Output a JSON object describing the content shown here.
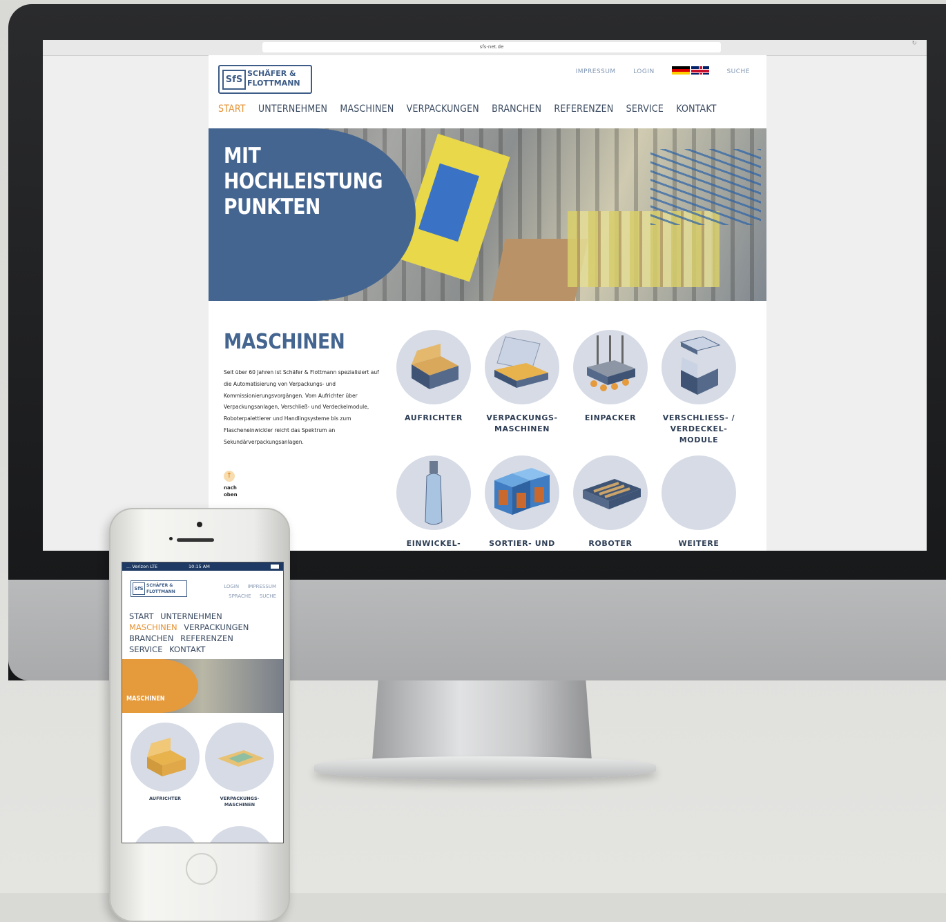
{
  "browser": {
    "url": "sfs-net.de"
  },
  "desktop_site": {
    "logo": {
      "mark": "SfS",
      "line1": "SCHÄFER &",
      "line2": "FLOTTMANN"
    },
    "top_links": [
      "IMPRESSUM",
      "LOGIN",
      "SUCHE"
    ],
    "nav": [
      {
        "label": "START",
        "active": true
      },
      {
        "label": "UNTERNEHMEN",
        "active": false
      },
      {
        "label": "MASCHINEN",
        "active": false
      },
      {
        "label": "VERPACKUNGEN",
        "active": false
      },
      {
        "label": "BRANCHEN",
        "active": false
      },
      {
        "label": "REFERENZEN",
        "active": false
      },
      {
        "label": "SERVICE",
        "active": false
      },
      {
        "label": "KONTAKT",
        "active": false
      }
    ],
    "hero": {
      "title": "MIT\nHOCHLEISTUNG\nPUNKTEN"
    },
    "section": {
      "title": "MASCHINEN",
      "text": "Seit über 60 Jahren ist Schäfer & Flottmann spezialisiert auf die Automatisierung von Verpackungs- und Kommissionierungsvorgängen. Vom Aufrichter über Verpackungsanlagen, Verschließ- und Verdeckelmodule, Roboterpalettierer und Handlingsysteme bis zum Flascheneinwickler reicht das Spektrum an Sekundärverpackungsanlagen.",
      "back_to_top": "nach\noben"
    },
    "tiles": [
      {
        "label": "AUFRICHTER",
        "icon": "box-erector-icon"
      },
      {
        "label": "VERPACKUNGS-\nMASCHINEN",
        "icon": "packaging-machine-icon"
      },
      {
        "label": "EINPACKER",
        "icon": "case-packer-icon"
      },
      {
        "label": "VERSCHLIESS- /\nVERDECKEL-\nMODULE",
        "icon": "lid-module-icon"
      },
      {
        "label": "EINWICKEL-",
        "icon": "bottle-wrapper-icon"
      },
      {
        "label": "SORTIER- UND",
        "icon": "sorting-icon"
      },
      {
        "label": "ROBOTER",
        "icon": "robot-tray-icon"
      },
      {
        "label": "WEITERE",
        "icon": "more-icon"
      }
    ],
    "colors": {
      "brand_blue": "#446590",
      "accent_orange": "#e59233",
      "tile_bg": "#d6dbe6"
    }
  },
  "mobile_site": {
    "status": {
      "carrier": "... Verizon  LTE",
      "time": "10:15 AM"
    },
    "logo": {
      "mark": "SfS",
      "line1": "SCHÄFER &",
      "line2": "FLOTTMANN"
    },
    "top_links": [
      "LOGIN",
      "IMPRESSUM",
      "SPRACHE",
      "SUCHE"
    ],
    "nav": [
      {
        "label": "START",
        "active": false
      },
      {
        "label": "UNTERNEHMEN",
        "active": false
      },
      {
        "label": "MASCHINEN",
        "active": true
      },
      {
        "label": "VERPACKUNGEN",
        "active": false
      },
      {
        "label": "BRANCHEN",
        "active": false
      },
      {
        "label": "REFERENZEN",
        "active": false
      },
      {
        "label": "SERVICE",
        "active": false
      },
      {
        "label": "KONTAKT",
        "active": false
      }
    ],
    "hero": {
      "title": "MASCHINEN"
    },
    "tiles": [
      {
        "label": "AUFRICHTER"
      },
      {
        "label": "VERPACKUNGS-\nMASCHINEN"
      }
    ]
  }
}
